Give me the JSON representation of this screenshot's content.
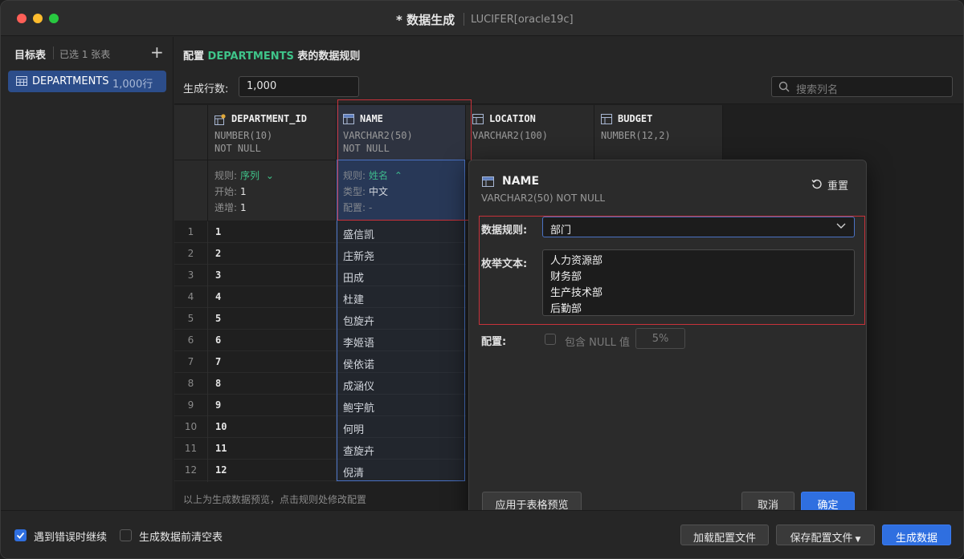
{
  "window": {
    "title": "* 数据生成",
    "connection": "LUCIFER[oracle19c]"
  },
  "sidebar": {
    "heading": "目标表",
    "selected_count": "已选 1 张表",
    "add_icon": "plus-icon",
    "tables": [
      {
        "name": "DEPARTMENTS",
        "rows": "1,000行"
      }
    ]
  },
  "main": {
    "heading_prefix": "配置",
    "heading_table": "DEPARTMENTS",
    "heading_suffix": "表的数据规则",
    "row_count_label": "生成行数:",
    "row_count_value": "1,000",
    "search_placeholder": "搜索列名",
    "footnote": "以上为生成数据预览，点击规则处修改配置"
  },
  "columns": [
    {
      "name": "DEPARTMENT_ID",
      "type": "NUMBER(10)",
      "nullable": "NOT NULL",
      "icon": "key-column-icon"
    },
    {
      "name": "NAME",
      "type": "VARCHAR2(50)",
      "nullable": "NOT NULL",
      "icon": "column-icon"
    },
    {
      "name": "LOCATION",
      "type": "VARCHAR2(100)",
      "nullable": "",
      "icon": "column-icon"
    },
    {
      "name": "BUDGET",
      "type": "NUMBER(12,2)",
      "nullable": "",
      "icon": "column-icon"
    }
  ],
  "rules": {
    "department_id": {
      "rule_label": "规则:",
      "rule_value": "序列",
      "start_label": "开始:",
      "start_value": "1",
      "step_label": "递增:",
      "step_value": "1"
    },
    "name": {
      "rule_label": "规则:",
      "rule_value": "姓名",
      "type_label": "类型:",
      "type_value": "中文",
      "config_label": "配置:",
      "config_value": "-"
    }
  },
  "rows": [
    {
      "n": "1",
      "id": "1",
      "name": "盛信凯"
    },
    {
      "n": "2",
      "id": "2",
      "name": "庄新尧"
    },
    {
      "n": "3",
      "id": "3",
      "name": "田成"
    },
    {
      "n": "4",
      "id": "4",
      "name": "杜建"
    },
    {
      "n": "5",
      "id": "5",
      "name": "包旋卉"
    },
    {
      "n": "6",
      "id": "6",
      "name": "李姬语"
    },
    {
      "n": "7",
      "id": "7",
      "name": "侯依诺"
    },
    {
      "n": "8",
      "id": "8",
      "name": "成涵仪"
    },
    {
      "n": "9",
      "id": "9",
      "name": "鲍宇航"
    },
    {
      "n": "10",
      "id": "10",
      "name": "何明"
    },
    {
      "n": "11",
      "id": "11",
      "name": "查旋卉"
    },
    {
      "n": "12",
      "id": "12",
      "name": "倪清"
    }
  ],
  "popup": {
    "column_name": "NAME",
    "column_type": "VARCHAR2(50) NOT NULL",
    "reset_label": "重置",
    "data_rule_label": "数据规则:",
    "data_rule_value": "部门",
    "enum_label": "枚举文本:",
    "enum_values": [
      "人力资源部",
      "财务部",
      "生产技术部",
      "后勤部"
    ],
    "config_label": "配置:",
    "include_null_label": "包含 NULL 值",
    "null_percent": "5%",
    "apply_label": "应用于表格预览",
    "cancel_label": "取消",
    "confirm_label": "确定"
  },
  "footer": {
    "continue_on_error": "遇到错误时继续",
    "continue_on_error_checked": true,
    "clear_before": "生成数据前清空表",
    "clear_before_checked": false,
    "load_config": "加载配置文件",
    "save_config": "保存配置文件",
    "generate": "生成数据"
  },
  "colors": {
    "accent_blue": "#2f6fe0",
    "accent_green": "#3fc48a",
    "highlight_red": "#c8323a"
  }
}
